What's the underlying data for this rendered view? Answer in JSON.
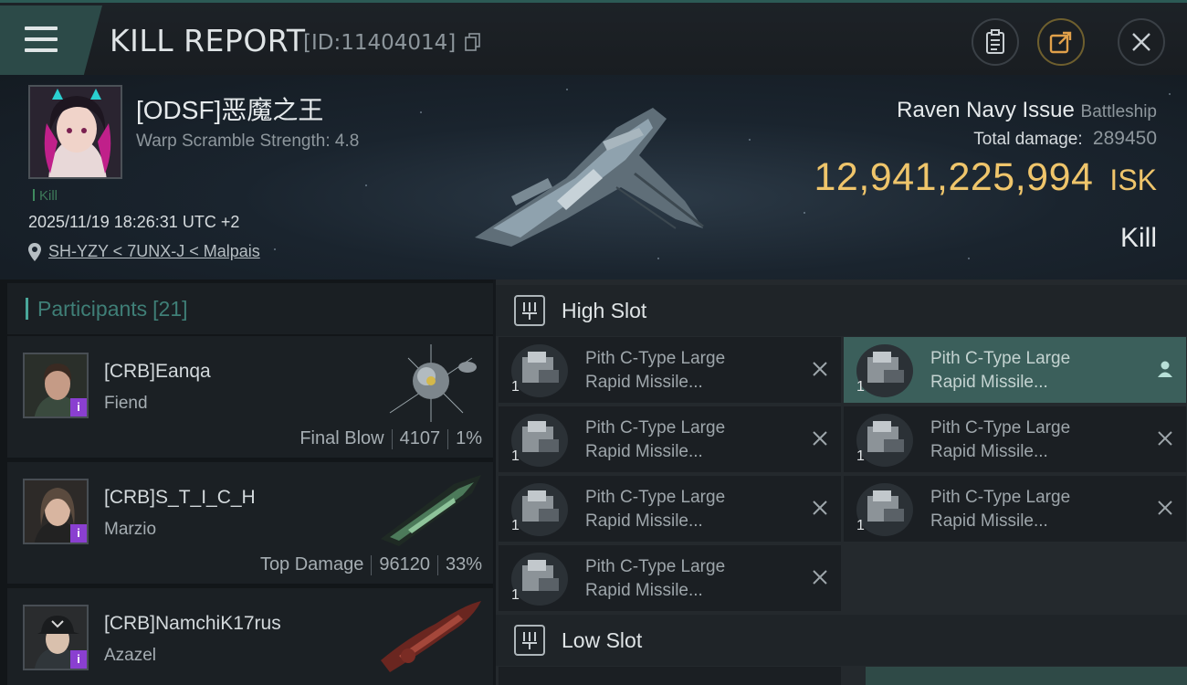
{
  "header": {
    "title": "KILL REPORT",
    "report_id": "[ID:11404014]"
  },
  "victim": {
    "name": "[ODSF]恶魔之王",
    "warp_scramble": "Warp Scramble Strength: 4.8",
    "tag": "Kill",
    "datetime": "2025/11/19 18:26:31 UTC +2",
    "location": "SH-YZY < 7UNX-J < Malpais"
  },
  "ship": {
    "name": "Raven Navy Issue",
    "class": "Battleship",
    "total_damage_label": "Total damage:",
    "total_damage_value": "289450",
    "isk_value": "12,941,225,994",
    "isk_unit": "ISK",
    "outcome": "Kill"
  },
  "participants": {
    "label": "Participants",
    "count": "[21]",
    "items": [
      {
        "name": "[CRB]Eanqa",
        "ship": "Fiend",
        "role": "Final Blow",
        "damage": "4107",
        "percent": "1%",
        "badge": "i"
      },
      {
        "name": "[CRB]S_T_I_C_H",
        "ship": "Marzio",
        "role": "Top Damage",
        "damage": "96120",
        "percent": "33%",
        "badge": "i"
      },
      {
        "name": "[CRB]NamchiK17rus",
        "ship": "Azazel",
        "badge": "i"
      }
    ]
  },
  "slots": {
    "high": {
      "label": "High Slot",
      "modules": [
        {
          "line1": "Pith C-Type Large",
          "line2": "Rapid Missile...",
          "qty": "1"
        },
        {
          "line1": "Pith C-Type Large",
          "line2": "Rapid Missile...",
          "qty": "1"
        },
        {
          "line1": "Pith C-Type Large",
          "line2": "Rapid Missile...",
          "qty": "1"
        },
        {
          "line1": "Pith C-Type Large",
          "line2": "Rapid Missile...",
          "qty": "1"
        },
        {
          "line1": "Pith C-Type Large",
          "line2": "Rapid Missile...",
          "qty": "1"
        },
        {
          "line1": "Pith C-Type Large",
          "line2": "Rapid Missile...",
          "qty": "1"
        },
        {
          "line1": "Pith C-Type Large",
          "line2": "Rapid Missile...",
          "qty": "1"
        }
      ]
    },
    "low": {
      "label": "Low Slot"
    }
  },
  "colors": {
    "isk": "#efc56b",
    "accent": "#4aa79a",
    "active_row": "#3b5f5b",
    "badge": "#8a3fd0"
  },
  "icons": [
    "menu-icon",
    "copy-icon",
    "clipboard-icon",
    "share-icon",
    "close-icon",
    "location-pin-icon",
    "slot-icon",
    "destroyed-x-icon",
    "pilot-icon"
  ]
}
